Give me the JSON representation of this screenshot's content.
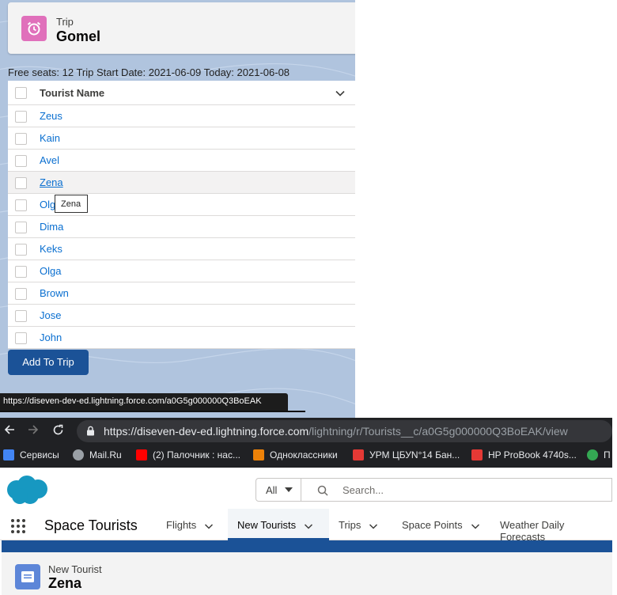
{
  "trip": {
    "object_label": "Trip",
    "record_name": "Gomel",
    "info_line": "Free seats: 12 Trip Start Date: 2021-06-09 Today: 2021-06-08",
    "column_header": "Tourist Name",
    "tourists": [
      "Zeus",
      "Kain",
      "Avel",
      "Zena",
      "Olga",
      "Dima",
      "Keks",
      "Olga",
      "Brown",
      "Jose",
      "John"
    ],
    "hover_row": 3,
    "tooltip": "Zena",
    "add_button": "Add To Trip",
    "status_url": "https://diseven-dev-ed.lightning.force.com/a0G5g000000Q3BoEAK"
  },
  "browser": {
    "url_host": "https://diseven-dev-ed.lightning.force.com",
    "url_path": "/lightning/r/Tourists__c/a0G5g000000Q3BoEAK/view",
    "bookmarks": [
      {
        "icon": "apps-icon",
        "label": "Сервисы",
        "color": "#4285f4"
      },
      {
        "icon": "globe-icon",
        "label": "Mail.Ru",
        "color": "#9aa0a6"
      },
      {
        "icon": "youtube-icon",
        "label": "(2) Палочник : нас...",
        "color": "#ff0000"
      },
      {
        "icon": "ok-icon",
        "label": "Одноклассники",
        "color": "#ee8208"
      },
      {
        "icon": "urm-icon",
        "label": "УРМ ЦБУN°14 Бан...",
        "color": "#e53935"
      },
      {
        "icon": "hp-icon",
        "label": "HP ProBook 4740s...",
        "color": "#e53935"
      },
      {
        "icon": "refresh-green-icon",
        "label": "П",
        "color": "#34a853"
      }
    ]
  },
  "salesforce": {
    "scope": "All",
    "search_placeholder": "Search...",
    "app_name": "Space Tourists",
    "tabs": [
      "Flights",
      "New Tourists",
      "Trips",
      "Space Points",
      "Weather Daily Forecasts"
    ],
    "active_tab": 1,
    "record_object": "New Tourist",
    "record_name": "Zena"
  }
}
